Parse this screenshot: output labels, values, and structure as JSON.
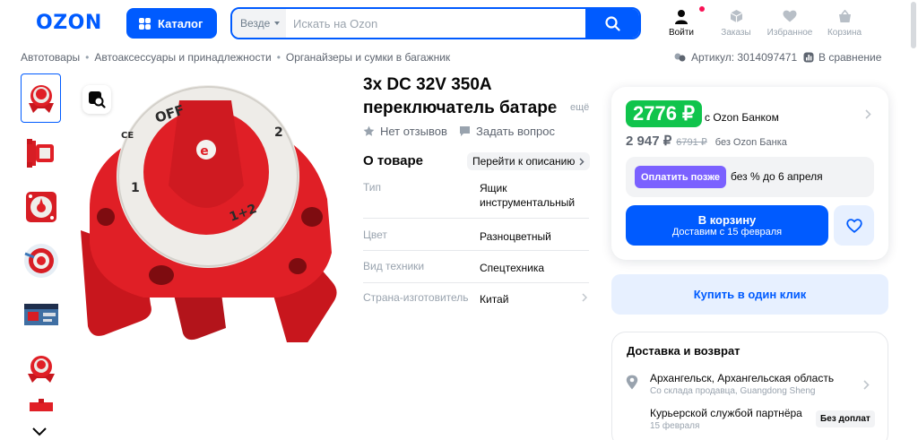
{
  "header": {
    "logo": "OZON",
    "catalog_label": "Каталог",
    "search_scope": "Везде",
    "search_placeholder": "Искать на Ozon",
    "nav": [
      {
        "label": "Войти",
        "icon": "user-icon"
      },
      {
        "label": "Заказы",
        "icon": "box-icon"
      },
      {
        "label": "Избранное",
        "icon": "heart-icon"
      },
      {
        "label": "Корзина",
        "icon": "cart-icon"
      }
    ]
  },
  "breadcrumbs": [
    "Автотовары",
    "Автоаксессуары и принадлежности",
    "Органайзеры и сумки в багажник"
  ],
  "article": "Артикул: 3014097471",
  "compare": "В сравнение",
  "product": {
    "title_line1": "3x DC 32V 350A",
    "title_line2": "переключатель батаре",
    "more": "ещё",
    "reviews": "Нет отзывов",
    "ask": "Задать вопрос",
    "about": "О товаре",
    "to_description": "Перейти к описанию",
    "specs": [
      {
        "key": "Тип",
        "value": "Ящик инструментальный"
      },
      {
        "key": "Цвет",
        "value": "Разноцветный"
      },
      {
        "key": "Вид техники",
        "value": "Спецтехника"
      },
      {
        "key": "Страна-изготовитель",
        "value": "Китай"
      }
    ]
  },
  "price": {
    "ozon_bank_price": "2776 ₽",
    "ozon_bank_label": "с Ozon Банком",
    "regular_price": "2 947 ₽",
    "old_price": "6791 ₽",
    "regular_label": "без Ozon Банка",
    "pay_later_button": "Оплатить позже",
    "pay_later_text": "без % до 6 апреля",
    "cart_button": "В корзину",
    "cart_delivery": "Доставим с 15 февраля",
    "one_click": "Купить в один клик"
  },
  "delivery": {
    "title": "Доставка и возврат",
    "location": "Архангельск, Архангельская область",
    "warehouse": "Со склада продавца, Guangdong Sheng",
    "courier": "Курьерской службой партнёра",
    "courier_date": "15 февраля",
    "badge": "Без доплат"
  },
  "colors": {
    "brand": "#005bff",
    "green": "#10c44c",
    "purple": "#7b61ff",
    "product_red": "#e01f26"
  }
}
